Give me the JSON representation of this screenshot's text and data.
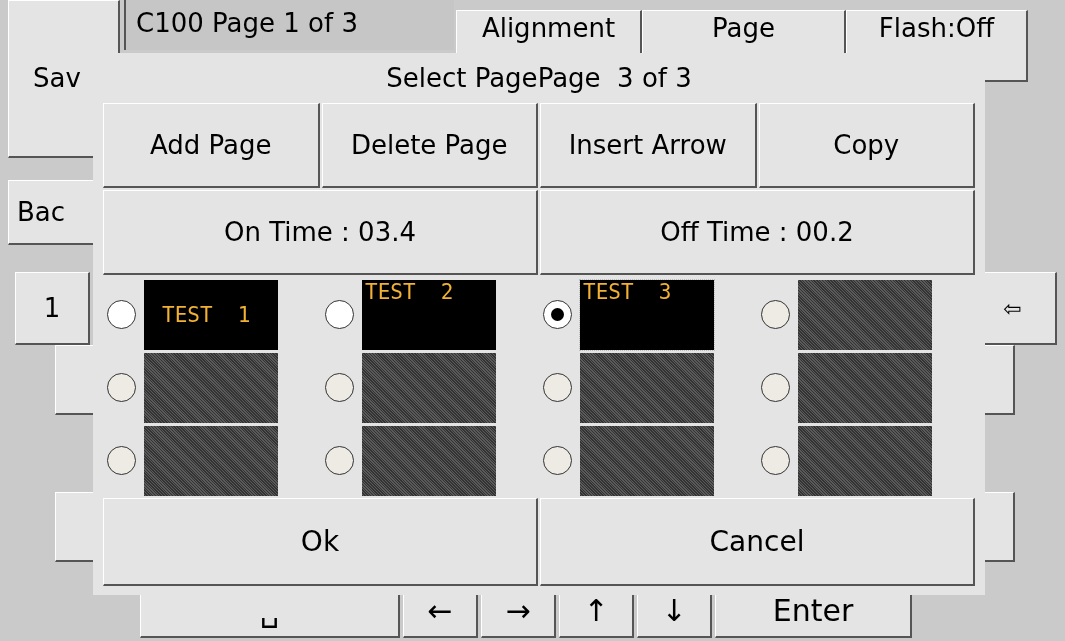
{
  "background": {
    "save_button": "Sav",
    "page_label": "C100 Page 1 of 3",
    "top_buttons": [
      "Alignment",
      "Page",
      "Flash:Off"
    ],
    "back_button": "Bac",
    "key_1": "1",
    "backspace_key": "⇦",
    "bottom_keys": [
      "␣",
      "←",
      "→",
      "↑",
      "↓",
      "Enter"
    ]
  },
  "dialog": {
    "title": "Select Page",
    "page_indicator": "Page  3 of 3",
    "actions": [
      "Add Page",
      "Delete Page",
      "Insert Arrow",
      "Copy"
    ],
    "times": [
      "On Time : 03.4",
      "Off Time : 00.2"
    ],
    "pages": [
      {
        "label": "TEST  1",
        "selected": false,
        "kind": "centered"
      },
      {
        "label": "TEST  2",
        "selected": false,
        "kind": "topped"
      },
      {
        "label": "TEST  3",
        "selected": true,
        "kind": "topped"
      },
      {
        "selected": false,
        "kind": "empty"
      },
      {
        "selected": false,
        "kind": "empty"
      },
      {
        "selected": false,
        "kind": "empty"
      },
      {
        "selected": false,
        "kind": "empty"
      },
      {
        "selected": false,
        "kind": "empty"
      },
      {
        "selected": false,
        "kind": "empty"
      },
      {
        "selected": false,
        "kind": "empty"
      },
      {
        "selected": false,
        "kind": "empty"
      },
      {
        "selected": false,
        "kind": "empty"
      }
    ],
    "buttons": [
      "Ok",
      "Cancel"
    ]
  }
}
